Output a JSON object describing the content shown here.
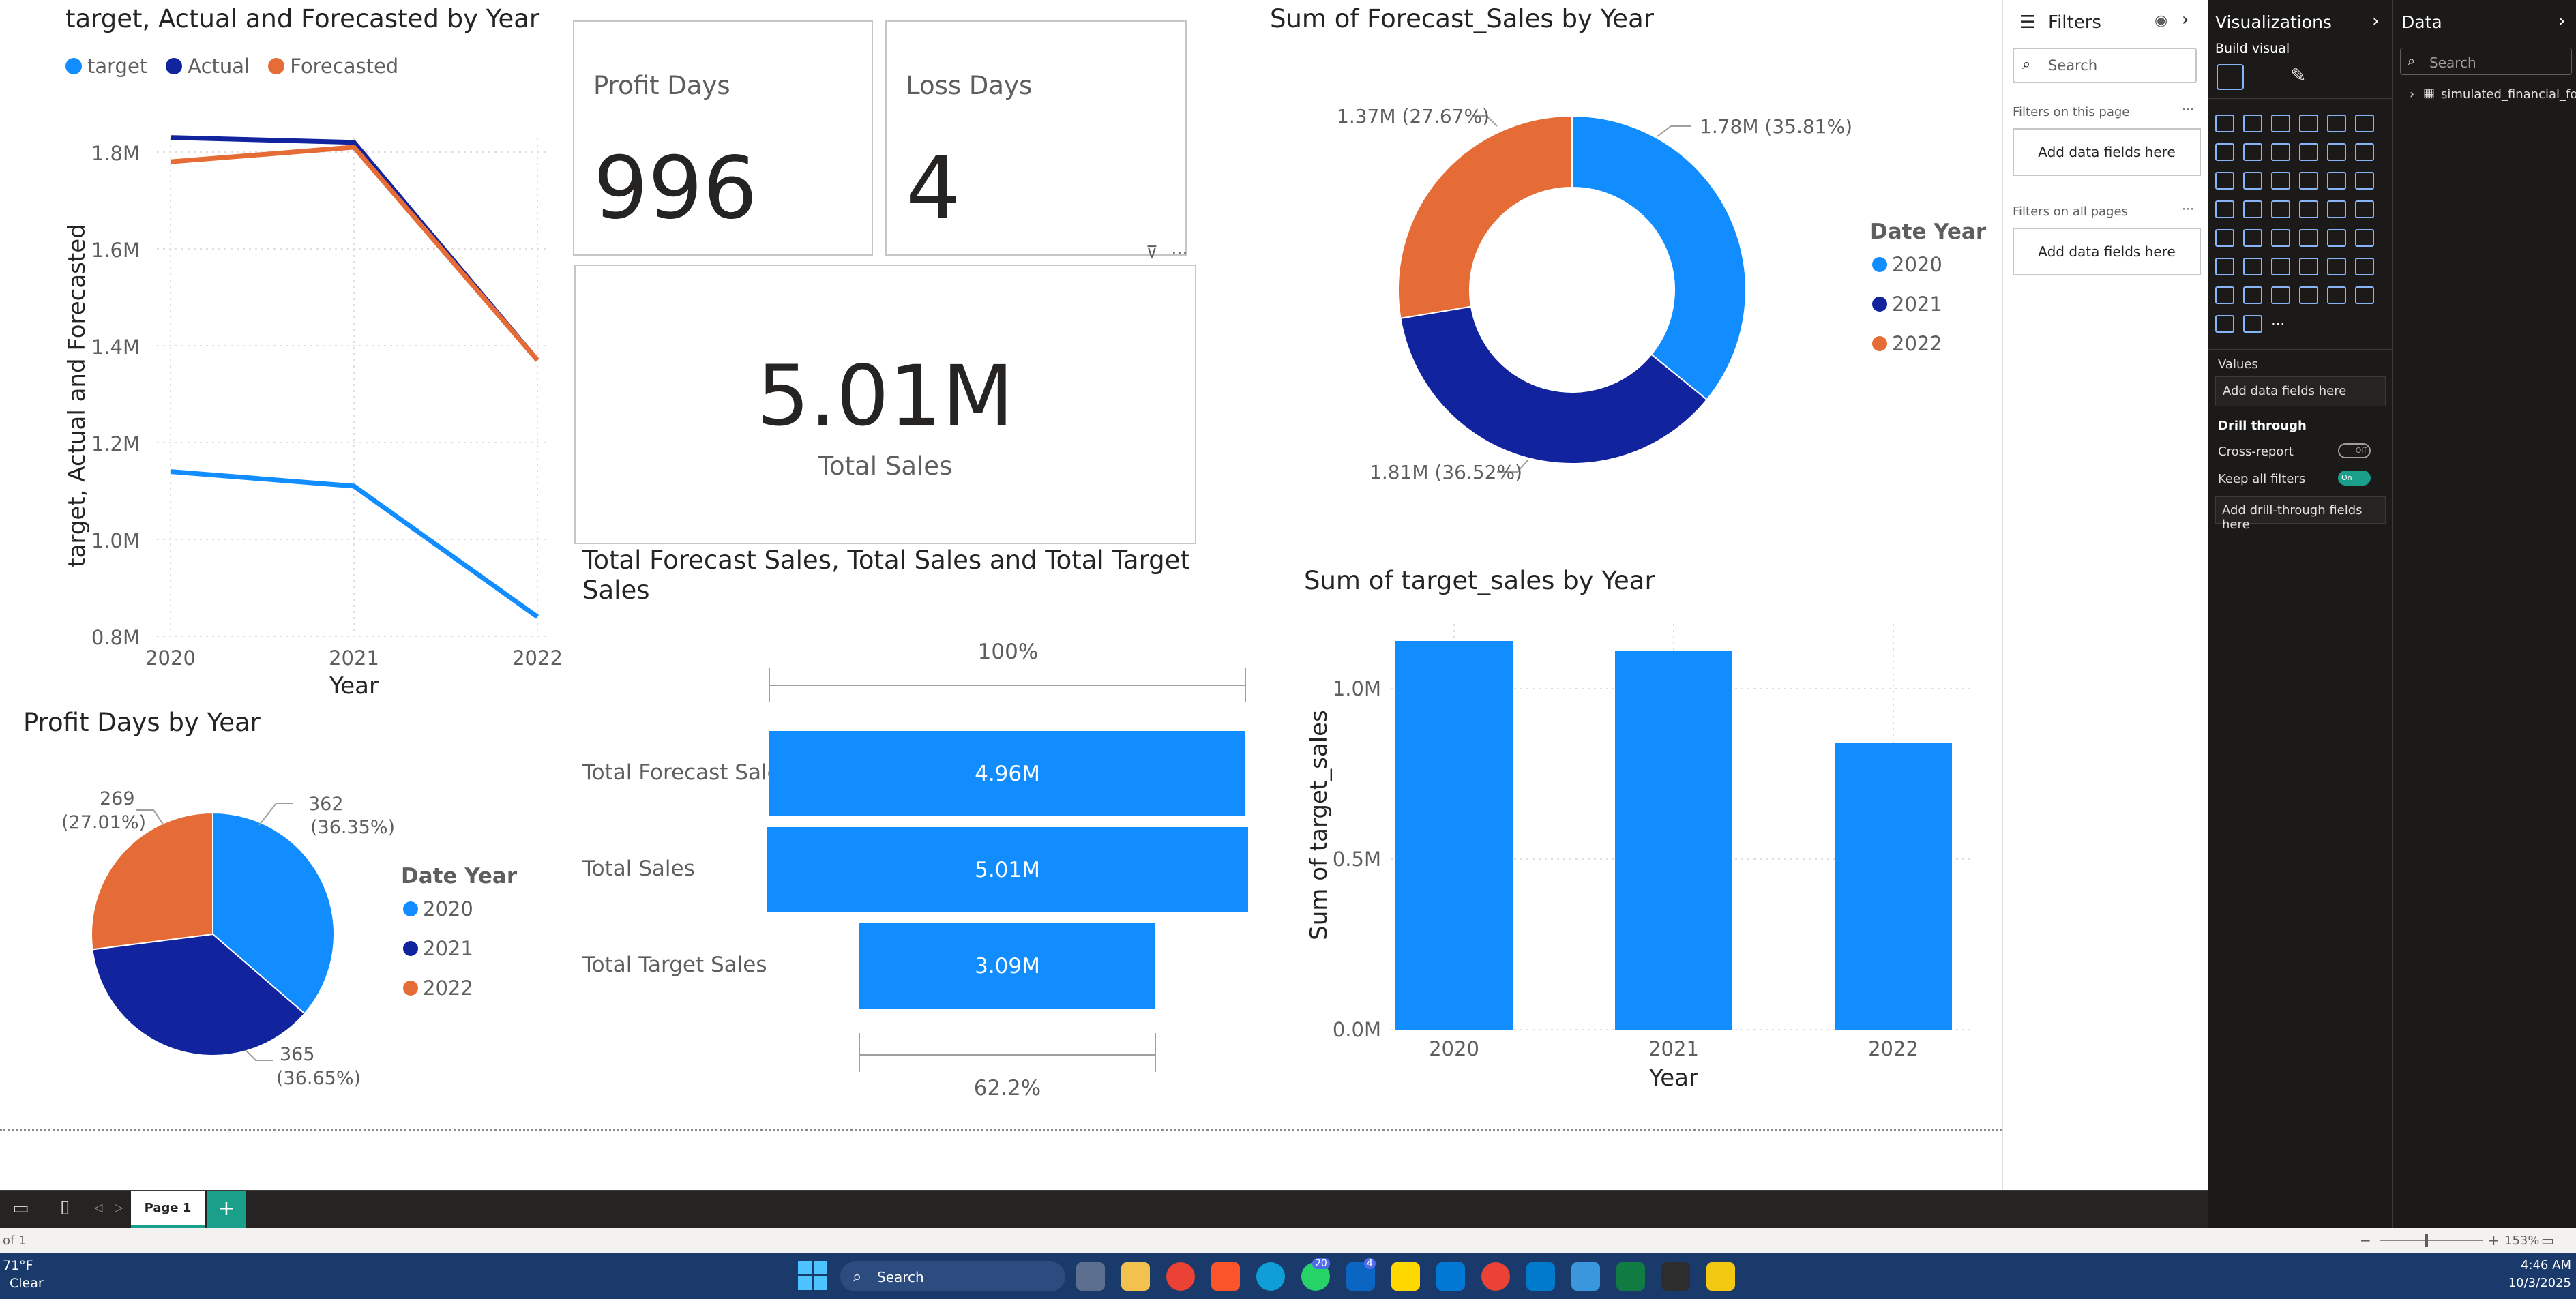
{
  "line_chart": {
    "title": "target, Actual and Forecasted by Year",
    "legend": [
      {
        "name": "target",
        "color": "#118dff"
      },
      {
        "name": "Actual",
        "color": "#12239e"
      },
      {
        "name": "Forecasted",
        "color": "#e66c37"
      }
    ],
    "xlabel": "Year",
    "ylabel": "target, Actual and Forecasted",
    "x_ticks": [
      "2020",
      "2021",
      "2022"
    ],
    "y_ticks": [
      "0.8M",
      "1.0M",
      "1.2M",
      "1.4M",
      "1.6M",
      "1.8M"
    ]
  },
  "cards": {
    "profit_days": {
      "title": "Profit Days",
      "value": "996"
    },
    "loss_days": {
      "title": "Loss Days",
      "value": "4"
    },
    "total_sales": {
      "value": "5.01M",
      "label": "Total Sales"
    }
  },
  "donut": {
    "title": "Sum of Forecast_Sales by Year",
    "legend_title": "Date Year",
    "legend": [
      "2020",
      "2021",
      "2022"
    ],
    "labels": [
      "1.78M (35.81%)",
      "1.81M (36.52%)",
      "1.37M (27.67%)"
    ]
  },
  "pie": {
    "title": "Profit Days by Year",
    "legend_title": "Date Year",
    "legend": [
      "2020",
      "2021",
      "2022"
    ],
    "labels": {
      "a_value": "362",
      "a_pct": "(36.35%)",
      "b_value": "365",
      "b_pct": "(36.65%)",
      "c_value": "269",
      "c_pct": "(27.01%)"
    }
  },
  "funnel": {
    "title_line1": "Total Forecast Sales, Total Sales and Total Target",
    "title_line2": "Sales",
    "top_pct": "100%",
    "bottom_pct": "62.2%",
    "rows": [
      {
        "label": "Total Forecast Sales",
        "value": "4.96M"
      },
      {
        "label": "Total Sales",
        "value": "5.01M"
      },
      {
        "label": "Total Target Sales",
        "value": "3.09M"
      }
    ]
  },
  "bar_chart": {
    "title": "Sum of target_sales by Year",
    "xlabel": "Year",
    "ylabel": "Sum of target_sales",
    "y_ticks": [
      "0.0M",
      "0.5M",
      "1.0M"
    ],
    "x_ticks": [
      "2020",
      "2021",
      "2022"
    ]
  },
  "chart_data": [
    {
      "type": "line",
      "title": "target, Actual and Forecasted by Year",
      "xlabel": "Year",
      "ylabel": "target, Actual and Forecasted",
      "x": [
        2020,
        2021,
        2022
      ],
      "ylim": [
        0.8,
        1.8
      ],
      "series": [
        {
          "name": "target",
          "values": [
            1.14,
            1.11,
            0.84
          ],
          "color": "#118dff"
        },
        {
          "name": "Actual",
          "values": [
            1.83,
            1.82,
            1.37
          ],
          "color": "#12239e"
        },
        {
          "name": "Forecasted",
          "values": [
            1.78,
            1.81,
            1.37
          ],
          "color": "#e66c37"
        }
      ]
    },
    {
      "type": "pie",
      "title": "Sum of Forecast_Sales by Year",
      "categories": [
        "2020",
        "2021",
        "2022"
      ],
      "values": [
        1.78,
        1.81,
        1.37
      ],
      "percents": [
        35.81,
        36.52,
        27.67
      ],
      "colors": [
        "#118dff",
        "#12239e",
        "#e66c37"
      ],
      "donut": true
    },
    {
      "type": "pie",
      "title": "Profit Days by Year",
      "categories": [
        "2020",
        "2021",
        "2022"
      ],
      "values": [
        362,
        365,
        269
      ],
      "percents": [
        36.35,
        36.65,
        27.01
      ],
      "colors": [
        "#118dff",
        "#12239e",
        "#e66c37"
      ]
    },
    {
      "type": "bar",
      "title": "Sum of target_sales by Year",
      "xlabel": "Year",
      "ylabel": "Sum of target_sales",
      "categories": [
        "2020",
        "2021",
        "2022"
      ],
      "values": [
        1.14,
        1.11,
        0.84
      ],
      "ylim": [
        0,
        1.2
      ],
      "color": "#118dff"
    },
    {
      "type": "bar",
      "title": "Total Forecast Sales, Total Sales and Total Target Sales",
      "categories": [
        "Total Forecast Sales",
        "Total Sales",
        "Total Target Sales"
      ],
      "values": [
        4.96,
        5.01,
        3.09
      ]
    }
  ],
  "filters_pane": {
    "title": "Filters",
    "search_placeholder": "Search",
    "on_this_page": "Filters on this page",
    "on_all_pages": "Filters on all pages",
    "add_fields": "Add data fields here"
  },
  "viz_pane": {
    "title": "Visualizations",
    "build_visual": "Build visual",
    "values": "Values",
    "values_add": "Add data fields here",
    "drill_through": "Drill through",
    "cross_report": "Cross-report",
    "cross_report_state": "Off",
    "keep_all_filters": "Keep all filters",
    "keep_all_filters_state": "On",
    "add_drill": "Add drill-through fields here"
  },
  "data_pane": {
    "title": "Data",
    "search_placeholder": "Search",
    "table": "simulated_financial_fo..."
  },
  "page_tabs": {
    "page1": "Page 1",
    "add": "+"
  },
  "status": {
    "page_of": "of 1",
    "zoom": "153%"
  },
  "taskbar": {
    "weather_temp": "71°F",
    "weather_cond": "Clear",
    "search": "Search",
    "time": "4:46 AM",
    "date": "10/3/2025",
    "badge_teams": "20",
    "badge_linkedin": "4"
  }
}
